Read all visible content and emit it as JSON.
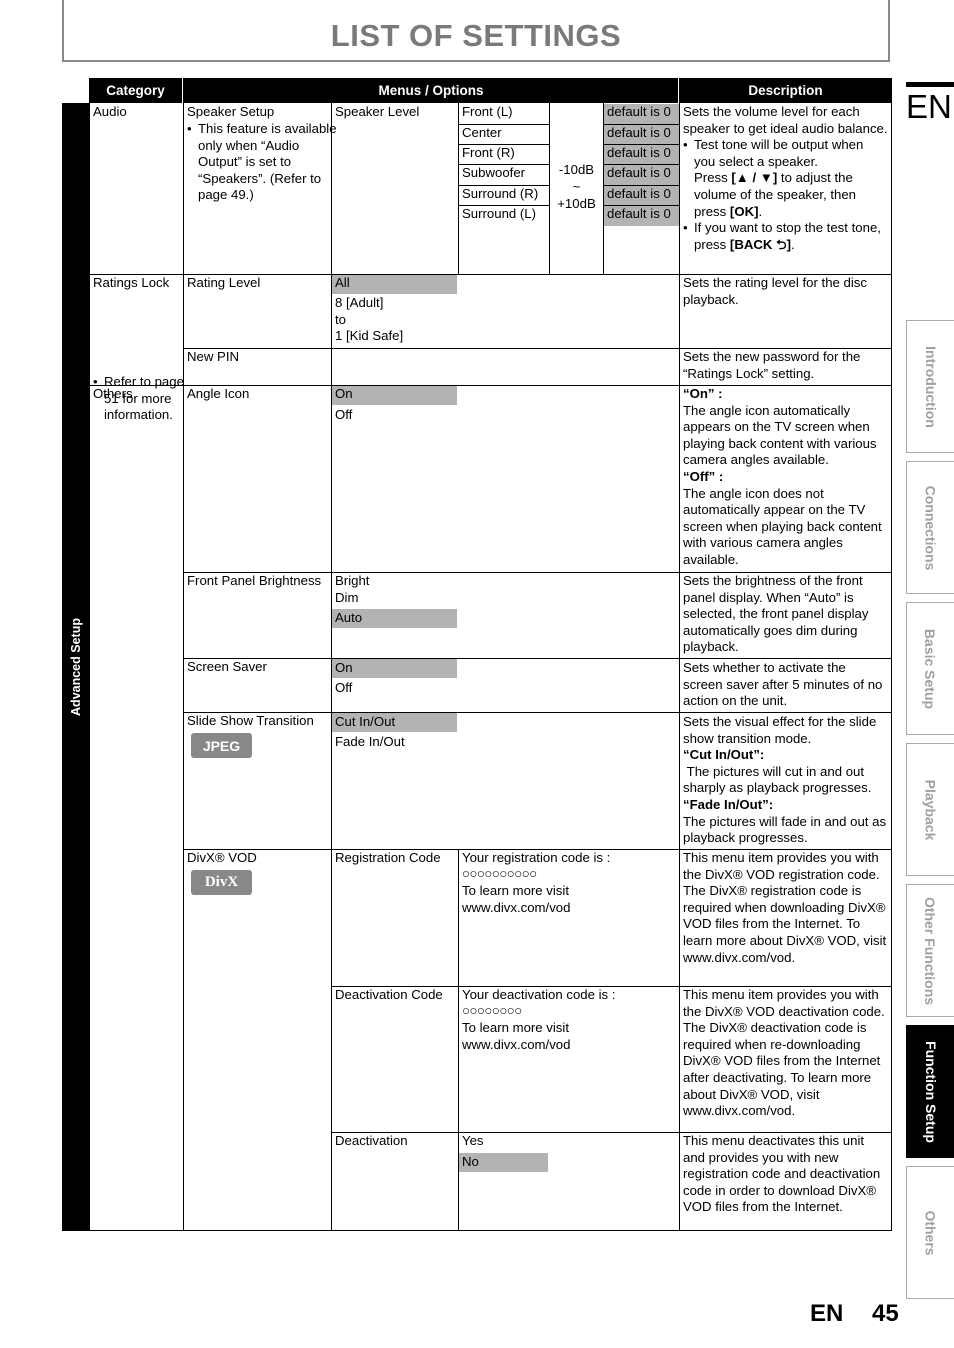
{
  "page": {
    "title": "LIST OF SETTINGS",
    "lang_badge": "EN",
    "footer_lang": "EN",
    "page_number": "45",
    "section_vertical_label": "Advanced Setup"
  },
  "table": {
    "headers": {
      "category": "Category",
      "menus": "Menus / Options",
      "description": "Description"
    }
  },
  "audio": {
    "category": "Audio",
    "menu": "Speaker Setup",
    "menu_note": "This feature is available only when “Audio Output” is set to “Speakers”. (Refer to page 49.)",
    "submenu": "Speaker Level",
    "speakers": [
      "Front (L)",
      "Center",
      "Front (R)",
      "Subwoofer",
      "Surround (R)",
      "Surround (L)"
    ],
    "range": {
      "min": "-10dB",
      "sep": "~",
      "max": "+10dB"
    },
    "default_label": "default is 0",
    "description": {
      "intro": "Sets the volume level for each speaker to get ideal audio balance.",
      "b1_line1": "Test tone will be output when you select a speaker.",
      "b1_press": "Press ",
      "b1_keys": "[▲ / ▼]",
      "b1_mid": " to adjust the volume of the speaker, then press ",
      "b1_ok": "[OK]",
      "b1_end": ".",
      "b2_text": "If you want to stop the test tone, press ",
      "b2_key": "[BACK ⮌]",
      "b2_end": "."
    }
  },
  "ratings": {
    "category": "Ratings Lock",
    "category_note": "Refer to page 51 for more information.",
    "rating_level": {
      "menu": "Rating Level",
      "options": [
        "All",
        "8 [Adult]",
        "to",
        "1 [Kid Safe]"
      ],
      "description": "Sets the rating level for the disc playback."
    },
    "new_pin": {
      "menu": "New PIN",
      "description": "Sets the new password for the “Ratings Lock” setting."
    }
  },
  "others": {
    "category": "Others",
    "angle_icon": {
      "menu": "Angle Icon",
      "options": [
        "On",
        "Off"
      ],
      "desc_on_head": "“On” :",
      "desc_on": "The angle icon automatically appears on the TV screen when playing back content with various camera angles available.",
      "desc_off_head": "“Off” :",
      "desc_off": "The angle icon does not automatically appear on the TV screen when playing back content with various camera angles available."
    },
    "front_panel": {
      "menu": "Front Panel Brightness",
      "options": [
        "Bright",
        "Dim",
        "Auto"
      ],
      "description": "Sets the brightness of the front panel display. When “Auto” is selected, the front panel display automatically goes dim during playback."
    },
    "screen_saver": {
      "menu": "Screen Saver",
      "options": [
        "On",
        "Off"
      ],
      "description": "Sets whether to activate the screen saver after 5 minutes of no action on the unit."
    },
    "slide_show": {
      "menu": "Slide Show Transition",
      "badge": "JPEG",
      "options": [
        "Cut In/Out",
        "Fade In/Out"
      ],
      "desc_intro": "Sets the visual effect for the slide show transition mode.",
      "desc_cut_head": "“Cut In/Out”:",
      "desc_cut": " The pictures will cut in and out sharply as playback progresses.",
      "desc_fade_head": "“Fade In/Out”:",
      "desc_fade": "The pictures will fade in and out as playback progresses."
    },
    "divx": {
      "menu": "DivX® VOD",
      "badge": "DivX",
      "registration": {
        "menu": "Registration Code",
        "line1": "Your registration code is :",
        "code": "○○○○○○○○○○",
        "line3": "To learn more visit",
        "line4": "www.divx.com/vod",
        "description": "This menu item provides you with the DivX® VOD registration code. The DivX® registration code is required when downloading DivX® VOD files from the Internet. To learn more about DivX® VOD, visit www.divx.com/vod."
      },
      "deactivation_code": {
        "menu": "Deactivation Code",
        "line1": "Your deactivation code is :",
        "code": "○○○○○○○○",
        "line3": "To learn more visit",
        "line4": "www.divx.com/vod",
        "description": "This menu item provides you with the DivX® VOD deactivation code. The DivX® deactivation code is required when re-downloading DivX® VOD files from the Internet after deactivating. To learn more about DivX® VOD, visit www.divx.com/vod."
      },
      "deactivation": {
        "menu": "Deactivation",
        "options": [
          "Yes",
          "No"
        ],
        "description": "This menu deactivates this unit and provides you with new registration code and deactivation code in order to download DivX® VOD files from the Internet."
      }
    }
  },
  "side_tabs": [
    {
      "label": "Introduction",
      "active": false
    },
    {
      "label": "Connections",
      "active": false
    },
    {
      "label": "Basic Setup",
      "active": false
    },
    {
      "label": "Playback",
      "active": false
    },
    {
      "label": "Other Functions",
      "active": false
    },
    {
      "label": "Function Setup",
      "active": true
    },
    {
      "label": "Others",
      "active": false
    }
  ],
  "colors": {
    "highlight": "#b3b3b3",
    "title_gray": "#7a7a7a",
    "badge_gray": "#888888",
    "tab_text": "#a0a0a0"
  }
}
